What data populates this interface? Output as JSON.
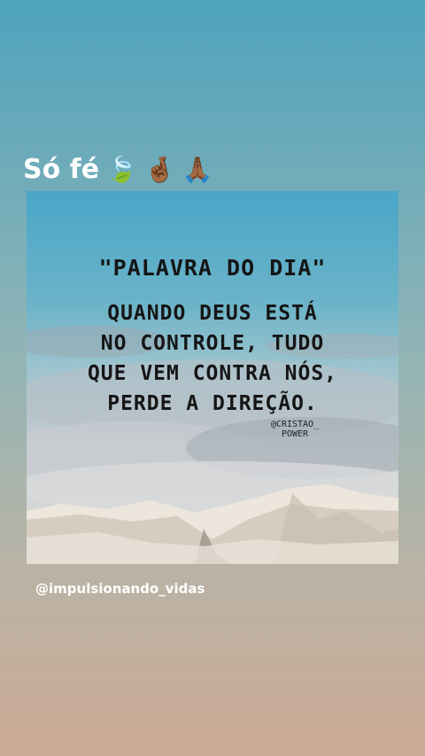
{
  "story": {
    "caption": "Só fé",
    "caption_emojis": [
      "🍃",
      "🤞🏾",
      "🙏🏾"
    ],
    "handle": "@impulsionando_vidas"
  },
  "post": {
    "title": "\"PALAVRA DO DIA\"",
    "lines": [
      "QUANDO DEUS ESTÁ",
      "NO CONTROLE, TUDO",
      "QUE VEM CONTRA NÓS,",
      "PERDE A DIREÇÃO."
    ],
    "credit_line1": "@CRISTAO_",
    "credit_line2": "POWER"
  }
}
